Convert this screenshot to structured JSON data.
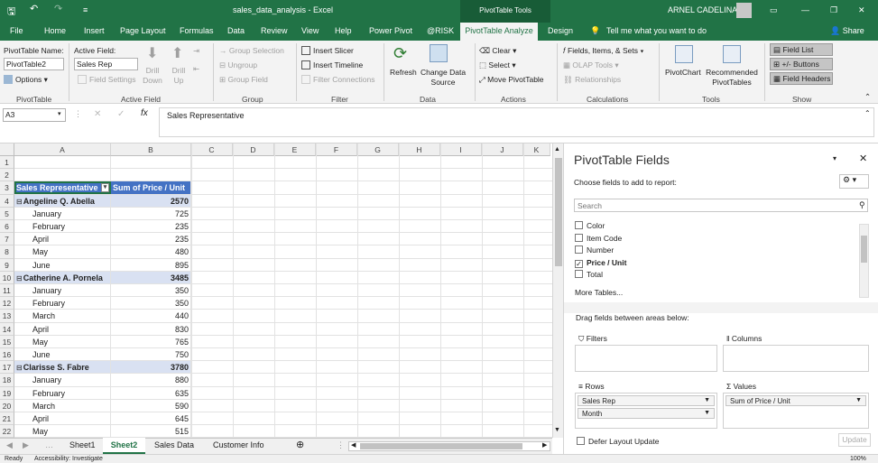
{
  "titlebar": {
    "file_name": "sales_data_analysis - Excel",
    "context_title": "PivotTable Tools",
    "user_name": "ARNEL CADELINA"
  },
  "tabs": [
    "File",
    "Home",
    "Insert",
    "Page Layout",
    "Formulas",
    "Data",
    "Review",
    "View",
    "Help",
    "Power Pivot",
    "@RISK"
  ],
  "active_tab": "PivotTable Analyze",
  "tab_design": "Design",
  "tell_me": "Tell me what you want to do",
  "share_label": "Share",
  "ribbon": {
    "pt_name_label": "PivotTable Name:",
    "pt_name_value": "PivotTable2",
    "options_label": "Options",
    "active_field_label": "Active Field:",
    "active_field_value": "Sales Rep",
    "field_settings": "Field Settings",
    "drill_down": "Drill Down",
    "drill_up": "Drill Up",
    "group_selection": "Group Selection",
    "ungroup": "Ungroup",
    "group_field": "Group Field",
    "insert_slicer": "Insert Slicer",
    "insert_timeline": "Insert Timeline",
    "filter_connections": "Filter Connections",
    "refresh": "Refresh",
    "change_data_source": "Change Data Source",
    "clear": "Clear",
    "select": "Select",
    "move_pivottable": "Move PivotTable",
    "fields_items_sets": "Fields, Items, & Sets",
    "olap_tools": "OLAP Tools",
    "relationships": "Relationships",
    "pivotchart": "PivotChart",
    "recommended_pivottables": "Recommended PivotTables",
    "field_list": "Field List",
    "plus_minus_buttons": "+/- Buttons",
    "field_headers": "Field Headers",
    "groups": {
      "pivottable": "PivotTable",
      "active_field": "Active Field",
      "group": "Group",
      "filter": "Filter",
      "data": "Data",
      "actions": "Actions",
      "calculations": "Calculations",
      "tools": "Tools",
      "show": "Show"
    }
  },
  "formula_bar": {
    "name_box": "A3",
    "content": "Sales Representative"
  },
  "grid": {
    "columns": [
      "A",
      "B",
      "C",
      "D",
      "E",
      "F",
      "G",
      "H",
      "I",
      "J",
      "K"
    ],
    "header_a": "Sales Representative",
    "header_b": "Sum of Price / Unit",
    "rows": [
      {
        "n": "1",
        "a": "",
        "b": "",
        "kind": "empty"
      },
      {
        "n": "2",
        "a": "",
        "b": "",
        "kind": "empty"
      },
      {
        "n": "3",
        "a": "Sales Representative",
        "b": "Sum of Price / Unit",
        "kind": "header"
      },
      {
        "n": "4",
        "a": "Angeline Q. Abella",
        "b": "2570",
        "kind": "group"
      },
      {
        "n": "5",
        "a": "January",
        "b": "725",
        "kind": "item"
      },
      {
        "n": "6",
        "a": "February",
        "b": "235",
        "kind": "item"
      },
      {
        "n": "7",
        "a": "April",
        "b": "235",
        "kind": "item"
      },
      {
        "n": "8",
        "a": "May",
        "b": "480",
        "kind": "item"
      },
      {
        "n": "9",
        "a": "June",
        "b": "895",
        "kind": "item"
      },
      {
        "n": "10",
        "a": "Catherine A. Pornela",
        "b": "3485",
        "kind": "group"
      },
      {
        "n": "11",
        "a": "January",
        "b": "350",
        "kind": "item"
      },
      {
        "n": "12",
        "a": "February",
        "b": "350",
        "kind": "item"
      },
      {
        "n": "13",
        "a": "March",
        "b": "440",
        "kind": "item"
      },
      {
        "n": "14",
        "a": "April",
        "b": "830",
        "kind": "item"
      },
      {
        "n": "15",
        "a": "May",
        "b": "765",
        "kind": "item"
      },
      {
        "n": "16",
        "a": "June",
        "b": "750",
        "kind": "item"
      },
      {
        "n": "17",
        "a": "Clarisse S. Fabre",
        "b": "3780",
        "kind": "group"
      },
      {
        "n": "18",
        "a": "January",
        "b": "880",
        "kind": "item"
      },
      {
        "n": "19",
        "a": "February",
        "b": "635",
        "kind": "item"
      },
      {
        "n": "20",
        "a": "March",
        "b": "590",
        "kind": "item"
      },
      {
        "n": "21",
        "a": "April",
        "b": "645",
        "kind": "item"
      },
      {
        "n": "22",
        "a": "May",
        "b": "515",
        "kind": "item"
      }
    ]
  },
  "sheet_tabs": [
    "Sheet1",
    "Sheet2",
    "Sales Data",
    "Customer Info"
  ],
  "active_sheet": "Sheet2",
  "status": {
    "ready": "Ready",
    "accessibility": "Accessibility: Investigate",
    "zoom": "100%"
  },
  "panel": {
    "title": "PivotTable Fields",
    "choose_label": "Choose fields to add to report:",
    "search_placeholder": "Search",
    "fields": [
      {
        "name": "Color",
        "checked": false
      },
      {
        "name": "Item Code",
        "checked": false
      },
      {
        "name": "Number",
        "checked": false
      },
      {
        "name": "Price / Unit",
        "checked": true
      },
      {
        "name": "Total",
        "checked": false
      }
    ],
    "more_tables": "More Tables...",
    "drag_label": "Drag fields between areas below:",
    "filters_label": "Filters",
    "columns_label": "Columns",
    "rows_label": "Rows",
    "values_label": "Values",
    "rows_fields": [
      "Sales Rep",
      "Month"
    ],
    "values_fields": [
      "Sum of Price / Unit"
    ],
    "defer_label": "Defer Layout Update",
    "update_label": "Update"
  },
  "colors": {
    "excel_green": "#217346",
    "header_blue": "#4472c4",
    "group_fill": "#d9e1f2"
  }
}
